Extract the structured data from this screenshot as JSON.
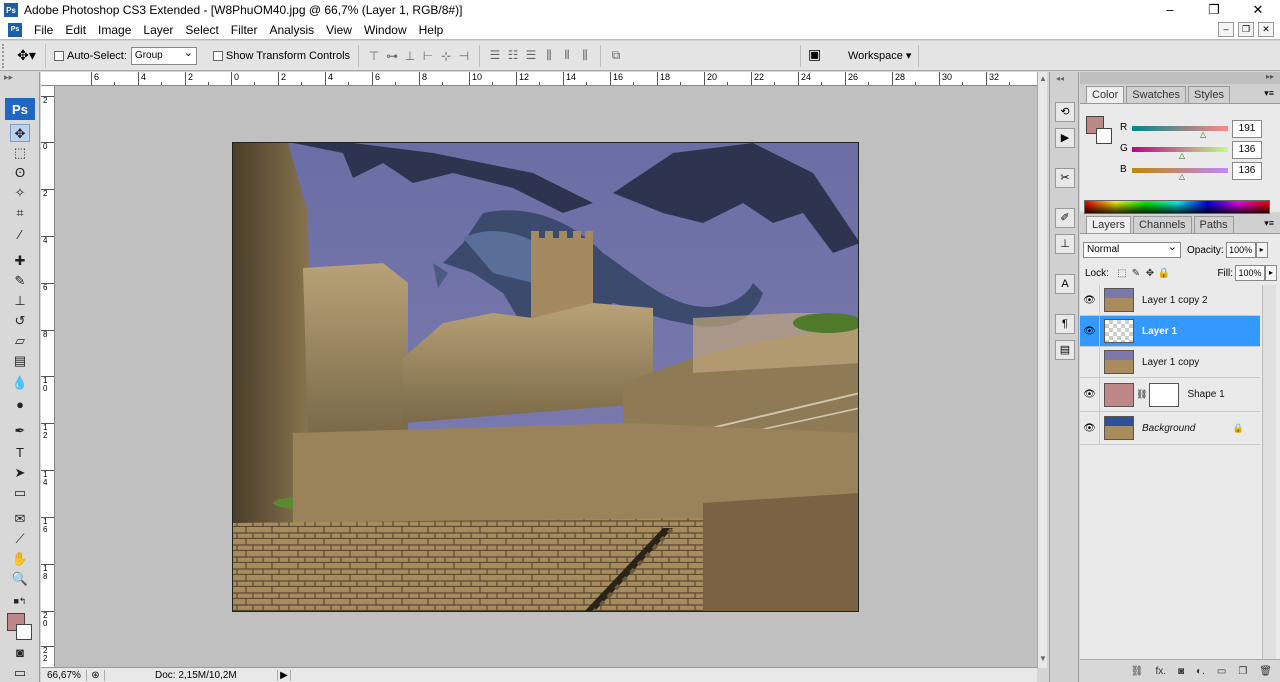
{
  "window": {
    "title": "Adobe Photoshop CS3 Extended - [W8PhuOM40.jpg @ 66,7% (Layer 1, RGB/8#)]",
    "app_icon": "Ps",
    "minimize": "–",
    "restore": "❐",
    "close": "✕"
  },
  "menu": {
    "items": [
      "File",
      "Edit",
      "Image",
      "Layer",
      "Select",
      "Filter",
      "Analysis",
      "View",
      "Window",
      "Help"
    ],
    "doc_controls": [
      "–",
      "❐",
      "✕"
    ]
  },
  "options": {
    "auto_select_label": "Auto-Select:",
    "auto_select_value": "Group",
    "show_transform_label": "Show Transform Controls",
    "workspace_label": "Workspace ▾"
  },
  "toolbox": {
    "badge": "Ps"
  },
  "rulers": {
    "top": [
      "6",
      "4",
      "2",
      "0",
      "2",
      "4",
      "6",
      "8",
      "10",
      "12",
      "14",
      "16",
      "18",
      "20",
      "22",
      "24",
      "26",
      "28",
      "30",
      "32"
    ],
    "left": [
      "2",
      "0",
      "2",
      "4",
      "6",
      "8",
      "1\n0",
      "1\n2",
      "1\n4",
      "1\n6",
      "1\n8",
      "2\n0",
      "2\n2",
      "2\n4"
    ]
  },
  "status": {
    "zoom": "66,67%",
    "doc": "Doc: 2,15M/10,2M",
    "play": "▶"
  },
  "color_panel": {
    "tabs": [
      "Color",
      "Swatches",
      "Styles"
    ],
    "active_tab": "Color",
    "foreground": "#bf8888",
    "sliders": [
      {
        "label": "R",
        "value": "191",
        "fraction": 0.75
      },
      {
        "label": "G",
        "value": "136",
        "fraction": 0.53
      },
      {
        "label": "B",
        "value": "136",
        "fraction": 0.53
      }
    ]
  },
  "layers_panel": {
    "tabs": [
      "Layers",
      "Channels",
      "Paths"
    ],
    "active_tab": "Layers",
    "blend_mode": "Normal",
    "opacity_label": "Opacity:",
    "opacity_value": "100%",
    "lock_label": "Lock:",
    "fill_label": "Fill:",
    "fill_value": "100%",
    "layers": [
      {
        "name": "Layer 1 copy 2",
        "visible": true
      },
      {
        "name": "Layer 1",
        "visible": true,
        "selected": true
      },
      {
        "name": "Layer 1 copy",
        "visible": false
      },
      {
        "name": "Shape 1",
        "visible": true
      },
      {
        "name": "Background",
        "visible": true,
        "locked": true
      }
    ]
  }
}
